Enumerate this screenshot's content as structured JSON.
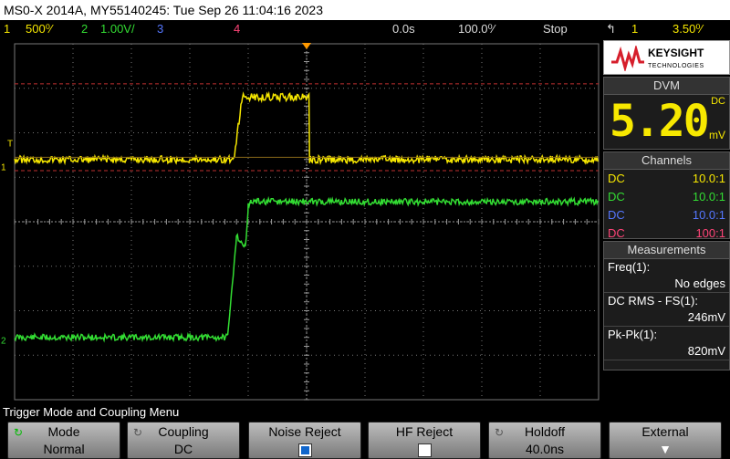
{
  "title": "MS0-X 2014A, MY55140245: Tue Sep 26 11:04:16 2023",
  "status": {
    "ch1_num": "1",
    "ch1_scale": "500⁰⁄",
    "ch2_num": "2",
    "ch2_scale": "1.00V/",
    "ch3_num": "3",
    "ch4_num": "4",
    "time_offset": "0.0s",
    "time_scale": "100.0⁰⁄",
    "run_state": "Stop",
    "trig_icon": "↰",
    "trig_ch": "1",
    "trig_level": "3.50⁰⁄"
  },
  "logo": {
    "brand": "KEYSIGHT",
    "sub": "TECHNOLOGIES"
  },
  "dvm": {
    "header": "DVM",
    "value": "5.20",
    "mode": "DC",
    "unit": "mV"
  },
  "channels": {
    "header": "Channels",
    "rows": [
      {
        "coupling": "DC",
        "probe": "10.0:1",
        "color": "#f7e800"
      },
      {
        "coupling": "DC",
        "probe": "10.0:1",
        "color": "#33dd33"
      },
      {
        "coupling": "DC",
        "probe": "10.0:1",
        "color": "#5577ff"
      },
      {
        "coupling": "DC",
        "probe": "100:1",
        "color": "#ff4477"
      }
    ]
  },
  "measurements": {
    "header": "Measurements",
    "items": [
      {
        "name": "Freq(1):",
        "value": "No edges"
      },
      {
        "name": "DC RMS - FS(1):",
        "value": "246mV"
      },
      {
        "name": "Pk-Pk(1):",
        "value": "820mV"
      }
    ]
  },
  "menu": {
    "title": "Trigger Mode and Coupling Menu",
    "keys": [
      {
        "label": "Mode",
        "value": "Normal"
      },
      {
        "label": "Coupling",
        "value": "DC"
      },
      {
        "label": "Noise Reject",
        "checked": true
      },
      {
        "label": "HF Reject",
        "checked": false
      },
      {
        "label": "Holdoff",
        "value": "40.0ns"
      },
      {
        "label": "External"
      }
    ]
  },
  "colors": {
    "ch1": "#f7e800",
    "ch2": "#33dd33",
    "grid": "#777777",
    "cursor": "#c03030",
    "trigger": "#ff9900"
  },
  "waveform_data": {
    "ch1_levels_div": [
      {
        "t_div": -5.0,
        "level_div": 1.4
      },
      {
        "t_div": -1.25,
        "level_div": 1.4
      },
      {
        "t_div": -1.1,
        "level_div": 2.8
      },
      {
        "t_div": 0.05,
        "level_div": 2.8
      },
      {
        "t_div": 0.05,
        "level_div": 1.4
      },
      {
        "t_div": 5.0,
        "level_div": 1.4
      }
    ],
    "ch2_levels_div": [
      {
        "t_div": -5.0,
        "level_div": -2.6
      },
      {
        "t_div": -1.35,
        "level_div": -2.6
      },
      {
        "t_div": -1.2,
        "level_div": -0.3
      },
      {
        "t_div": -1.05,
        "level_div": -0.6
      },
      {
        "t_div": -1.0,
        "level_div": 0.35
      },
      {
        "t_div": -0.95,
        "level_div": 0.45
      },
      {
        "t_div": 5.0,
        "level_div": 0.45
      }
    ],
    "ch1_ref_div": 1.2,
    "ch2_ref_div": -2.7,
    "trigger_level_div": 1.45,
    "cursor_upper_div": 3.1,
    "cursor_lower_div": 1.15
  }
}
